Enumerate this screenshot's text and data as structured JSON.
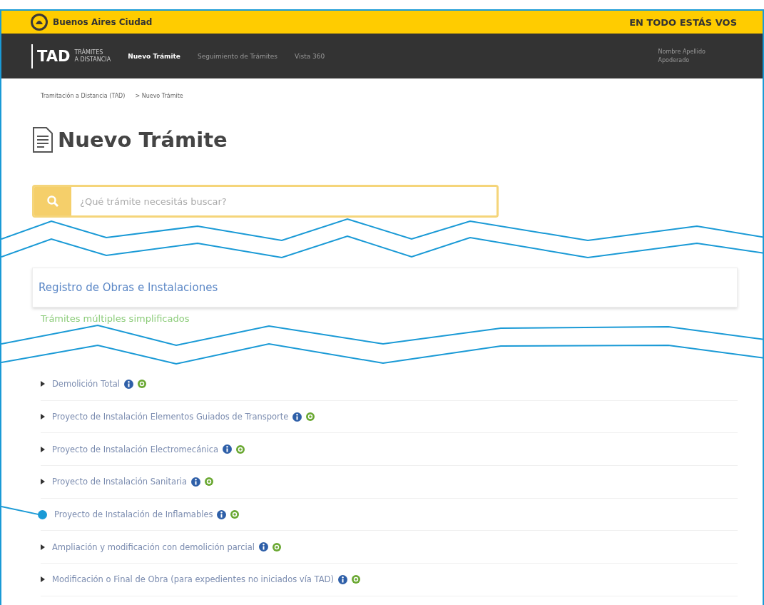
{
  "topbar": {
    "brand": "Buenos Aires Ciudad",
    "slogan": "EN TODO ESTÁS VOS"
  },
  "navbar": {
    "logo": "TAD",
    "logo_sub": [
      "TRÁMITES",
      "A DISTANCIA"
    ],
    "links": [
      {
        "label": "Nuevo Trámite",
        "selected": true
      },
      {
        "label": "Seguimiento de Trámites",
        "selected": false
      },
      {
        "label": "Vista 360",
        "selected": false
      }
    ],
    "user": [
      "Nombre Apellido",
      "Apoderado"
    ]
  },
  "breadcrumb": [
    "Tramitación a Distancia (TAD)",
    "> Nuevo Trámite"
  ],
  "title": "Nuevo Trámite",
  "search": {
    "placeholder": "¿Qué trámite necesitás buscar?"
  },
  "category": {
    "title": "Registro de Obras e Instalaciones",
    "subtitle": "Trámites múltiples simplificados",
    "items": [
      {
        "label": "Demolición Total",
        "highlighted": false
      },
      {
        "label": "Proyecto de Instalación Elementos Guiados de Transporte",
        "highlighted": false
      },
      {
        "label": "Proyecto de Instalación Electromecánica",
        "highlighted": false
      },
      {
        "label": "Proyecto de Instalación Sanitaria",
        "highlighted": false
      },
      {
        "label": "Proyecto de Instalación de Inflamables",
        "highlighted": true
      },
      {
        "label": "Ampliación y modificación con demolición parcial",
        "highlighted": false
      },
      {
        "label": "Modificación o Final de Obra (para expedientes no iniciados vía TAD)",
        "highlighted": false
      }
    ]
  }
}
